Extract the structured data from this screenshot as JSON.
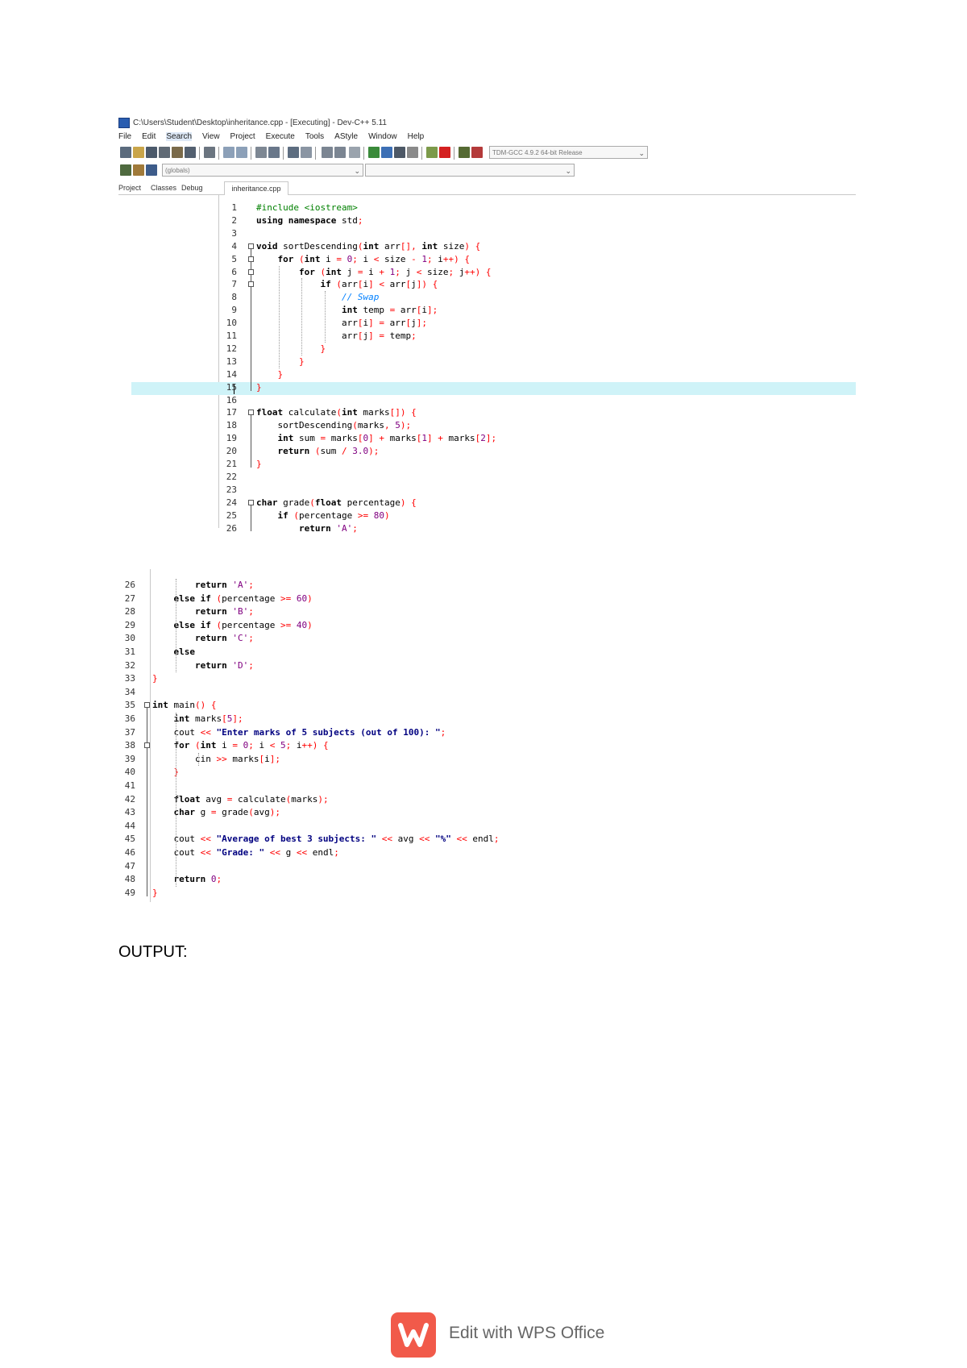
{
  "window": {
    "title": "C:\\Users\\Student\\Desktop\\inheritance.cpp - [Executing] - Dev-C++ 5.11",
    "menu": [
      "File",
      "Edit",
      "Search",
      "View",
      "Project",
      "Execute",
      "Tools",
      "AStyle",
      "Window",
      "Help"
    ],
    "compiler_combo": "TDM-GCC 4.9.2 64-bit Release",
    "globals_combo": "(globals)",
    "left_tabs": [
      "Project",
      "Classes",
      "Debug"
    ],
    "file_tab": "inheritance.cpp"
  },
  "code_part1": [
    "#include <iostream>",
    "using namespace std;",
    "",
    "void sortDescending(int arr[], int size) {",
    "    for (int i = 0; i < size - 1; i++) {",
    "        for (int j = i + 1; j < size; j++) {",
    "            if (arr[i] < arr[j]) {",
    "                // Swap",
    "                int temp = arr[i];",
    "                arr[i] = arr[j];",
    "                arr[j] = temp;",
    "            }",
    "        }",
    "    }",
    "}",
    "",
    "float calculate(int marks[]) {",
    "    sortDescending(marks, 5);",
    "    int sum = marks[0] + marks[1] + marks[2];",
    "    return (sum / 3.0);",
    "}",
    "",
    "",
    "char grade(float percentage) {",
    "    if (percentage >= 80)",
    "        return 'A';"
  ],
  "code_part2": [
    "        return 'A';",
    "    else if (percentage >= 60)",
    "        return 'B';",
    "    else if (percentage >= 40)",
    "        return 'C';",
    "    else",
    "        return 'D';",
    "}",
    "",
    "int main() {",
    "    int marks[5];",
    "    cout << \"Enter marks of 5 subjects (out of 100): \";",
    "    for (int i = 0; i < 5; i++) {",
    "        cin >> marks[i];",
    "    }",
    "",
    "    float avg = calculate(marks);",
    "    char g = grade(avg);",
    "",
    "    cout << \"Average of best 3 subjects: \" << avg << \"%\" << endl;",
    "    cout << \"Grade: \" << g << endl;",
    "",
    "    return 0;",
    "}"
  ],
  "output_heading": "OUTPUT:",
  "footer": {
    "text": "Edit with WPS Office"
  }
}
